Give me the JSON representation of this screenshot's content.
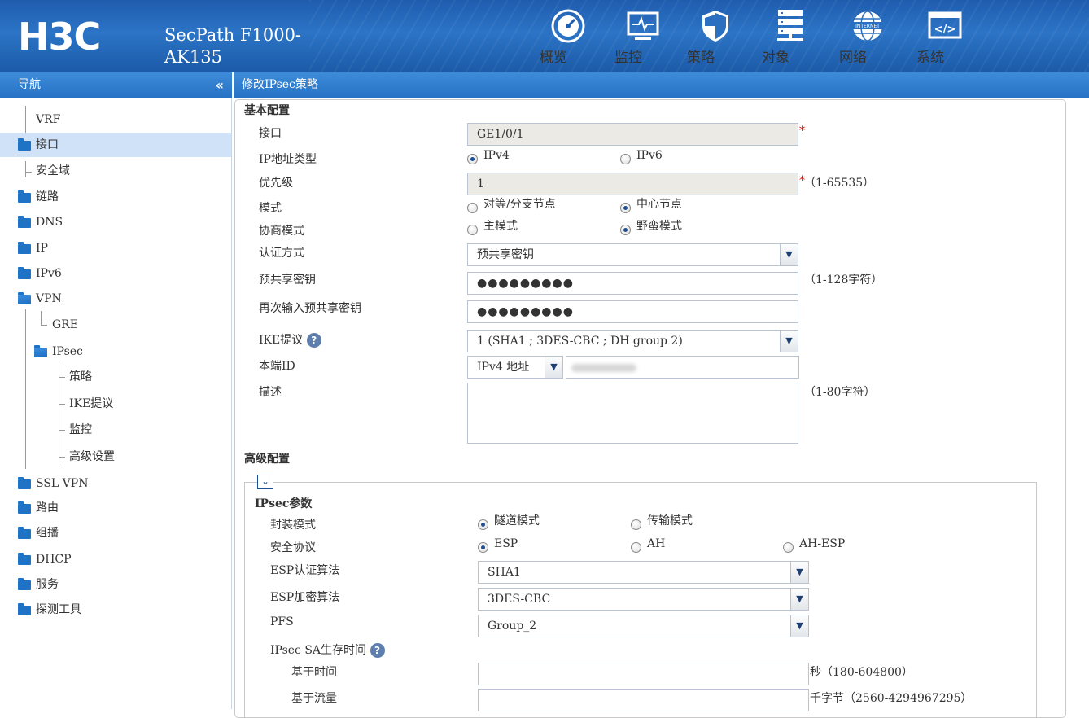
{
  "header": {
    "logo": "H3C",
    "product_line1": "SecPath F1000-",
    "product_line2": "AK135",
    "nav": [
      {
        "label": "概览",
        "icon": "dashboard-icon"
      },
      {
        "label": "监控",
        "icon": "monitor-icon"
      },
      {
        "label": "策略",
        "icon": "shield-icon"
      },
      {
        "label": "对象",
        "icon": "server-stack-icon"
      },
      {
        "label": "网络",
        "icon": "globe-internet-icon"
      },
      {
        "label": "系统",
        "icon": "code-window-icon"
      }
    ]
  },
  "sidebar": {
    "title": "导航",
    "collapse_label": "«",
    "items": [
      {
        "label": "VRF"
      },
      {
        "label": "接口"
      },
      {
        "label": "安全域"
      },
      {
        "label": "链路"
      },
      {
        "label": "DNS"
      },
      {
        "label": "IP"
      },
      {
        "label": "IPv6"
      },
      {
        "label": "VPN"
      },
      {
        "label": "GRE"
      },
      {
        "label": "IPsec"
      },
      {
        "label": "策略"
      },
      {
        "label": "IKE提议"
      },
      {
        "label": "监控"
      },
      {
        "label": "高级设置"
      },
      {
        "label": "SSL VPN"
      },
      {
        "label": "路由"
      },
      {
        "label": "组播"
      },
      {
        "label": "DHCP"
      },
      {
        "label": "服务"
      },
      {
        "label": "探测工具"
      }
    ],
    "active": "接口"
  },
  "page": {
    "title": "修改IPsec策略",
    "basic": {
      "section": "基本配置",
      "interface_label": "接口",
      "interface_value": "GE1/0/1",
      "ip_type_label": "IP地址类型",
      "ip_type_opts": [
        "IPv4",
        "IPv6"
      ],
      "ip_type_selected": "IPv4",
      "priority_label": "优先级",
      "priority_value": "1",
      "priority_hint": "（1-65535）",
      "mode_label": "模式",
      "mode_opts": [
        "对等/分支节点",
        "中心节点"
      ],
      "mode_selected": "中心节点",
      "nego_label": "协商模式",
      "nego_opts": [
        "主模式",
        "野蛮模式"
      ],
      "nego_selected": "野蛮模式",
      "auth_label": "认证方式",
      "auth_value": "预共享密钥",
      "psk_label": "预共享密钥",
      "psk_value": "●●●●●●●●●",
      "psk_hint": "（1-128字符）",
      "psk2_label": "再次输入预共享密钥",
      "psk2_value": "●●●●●●●●●",
      "ike_label": "IKE提议",
      "ike_value": "1 (SHA1 ; 3DES-CBC ; DH group 2)",
      "localid_label": "本端ID",
      "localid_type": "IPv4 地址",
      "desc_label": "描述",
      "desc_hint": "（1-80字符）",
      "required_mark": "*",
      "help_mark": "?"
    },
    "advanced": {
      "section": "高级配置",
      "toggle_icon": "⌄",
      "group": "IPsec参数",
      "encap_label": "封装模式",
      "encap_opts": [
        "隧道模式",
        "传输模式"
      ],
      "encap_selected": "隧道模式",
      "proto_label": "安全协议",
      "proto_opts": [
        "ESP",
        "AH",
        "AH-ESP"
      ],
      "proto_selected": "ESP",
      "esp_auth_label": "ESP认证算法",
      "esp_auth_value": "SHA1",
      "esp_enc_label": "ESP加密算法",
      "esp_enc_value": "3DES-CBC",
      "pfs_label": "PFS",
      "pfs_value": "Group_2",
      "lifetime_label": "IPsec SA生存时间",
      "time_label": "基于时间",
      "time_hint": "秒（180-604800）",
      "traffic_label": "基于流量",
      "traffic_hint": "千字节（2560-4294967295）"
    }
  }
}
